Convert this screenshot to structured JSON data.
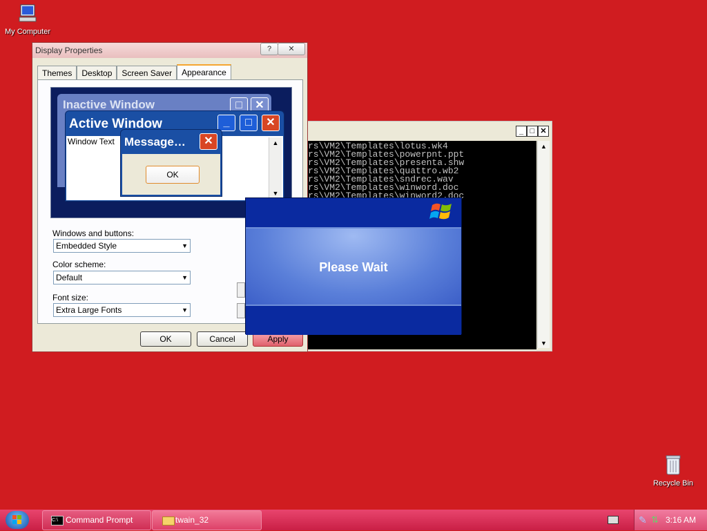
{
  "desktop": {
    "icons": [
      {
        "label": "My Computer"
      },
      {
        "label": "Recycle Bin"
      }
    ]
  },
  "display_properties": {
    "title": "Display Properties",
    "help_label": "?",
    "close_label": "✕",
    "tabs": [
      "Themes",
      "Desktop",
      "Screen Saver",
      "Appearance"
    ],
    "active_tab": "Appearance",
    "preview": {
      "inactive_title": "Inactive Window",
      "active_title": "Active Window",
      "window_text": "Window Text",
      "message_title": "Message…",
      "ok_label": "OK"
    },
    "windows_buttons_label": "Windows and buttons:",
    "windows_buttons_value": "Embedded Style",
    "color_scheme_label": "Color scheme:",
    "color_scheme_value": "Default",
    "font_size_label": "Font size:",
    "font_size_value": "Extra Large Fonts",
    "ok": "OK",
    "cancel": "Cancel",
    "apply": "Apply"
  },
  "command_prompt": {
    "lines": [
      "rs\\VM2\\Templates\\lotus.wk4",
      "rs\\VM2\\Templates\\powerpnt.ppt",
      "rs\\VM2\\Templates\\presenta.shw",
      "rs\\VM2\\Templates\\quattro.wb2",
      "rs\\VM2\\Templates\\sndrec.wav",
      "rs\\VM2\\Templates\\winword.doc",
      "rs\\VM2\\Templates\\winword2.doc"
    ]
  },
  "please_wait": {
    "text": "Please Wait"
  },
  "taskbar": {
    "items": [
      {
        "label": "Command Prompt",
        "active": false
      },
      {
        "label": "twain_32",
        "active": true
      }
    ],
    "clock": "3:16 AM"
  }
}
